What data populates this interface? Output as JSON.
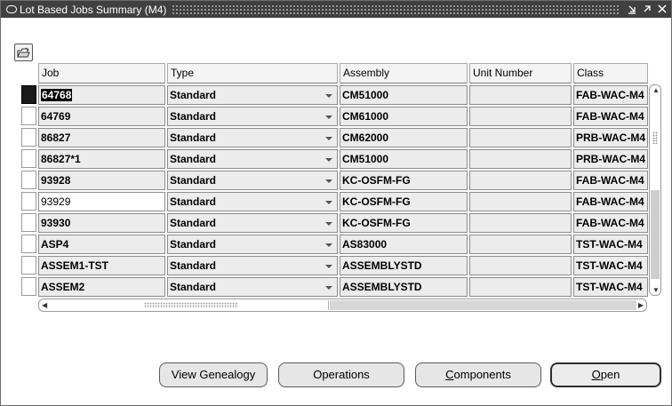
{
  "window": {
    "title": "Lot Based Jobs Summary (M4)"
  },
  "table": {
    "columns": [
      "Job",
      "Type",
      "Assembly",
      "Unit Number",
      "Class"
    ],
    "rows": [
      {
        "job": "64768",
        "type": "Standard",
        "assembly": "CM51000",
        "unit_number": "",
        "class": "FAB-WAC-M4",
        "current": true
      },
      {
        "job": "64769",
        "type": "Standard",
        "assembly": "CM61000",
        "unit_number": "",
        "class": "FAB-WAC-M4"
      },
      {
        "job": "86827",
        "type": "Standard",
        "assembly": "CM62000",
        "unit_number": "",
        "class": "PRB-WAC-M4"
      },
      {
        "job": "86827*1",
        "type": "Standard",
        "assembly": "CM51000",
        "unit_number": "",
        "class": "PRB-WAC-M4"
      },
      {
        "job": "93928",
        "type": "Standard",
        "assembly": "KC-OSFM-FG",
        "unit_number": "",
        "class": "FAB-WAC-M4"
      },
      {
        "job": "93929",
        "type": "Standard",
        "assembly": "KC-OSFM-FG",
        "unit_number": "",
        "class": "FAB-WAC-M4"
      },
      {
        "job": "93930",
        "type": "Standard",
        "assembly": "KC-OSFM-FG",
        "unit_number": "",
        "class": "FAB-WAC-M4"
      },
      {
        "job": "ASP4",
        "type": "Standard",
        "assembly": "AS83000",
        "unit_number": "",
        "class": "TST-WAC-M4"
      },
      {
        "job": "ASSEM1-TST",
        "type": "Standard",
        "assembly": "ASSEMBLYSTD",
        "unit_number": "",
        "class": "TST-WAC-M4"
      },
      {
        "job": "ASSEM2",
        "type": "Standard",
        "assembly": "ASSEMBLYSTD",
        "unit_number": "",
        "class": "TST-WAC-M4"
      }
    ]
  },
  "buttons": {
    "view_genealogy": "View Genealogy",
    "operations": "Operations",
    "components": "Components",
    "open": "Open"
  },
  "icons": {
    "toolbar": "open-folder-icon"
  }
}
